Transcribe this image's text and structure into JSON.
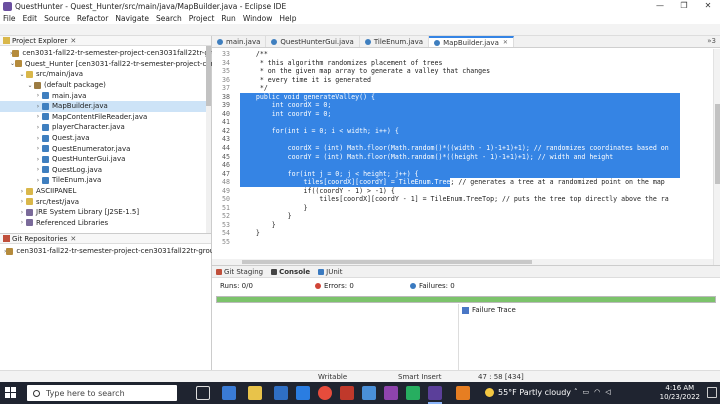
{
  "window": {
    "title": "QuestHunter - Quest_Hunter/src/main/java/MapBuilder.java - Eclipse IDE",
    "minimize": "—",
    "maximize": "❐",
    "close": "✕"
  },
  "menu": [
    "File",
    "Edit",
    "Source",
    "Refactor",
    "Navigate",
    "Search",
    "Project",
    "Run",
    "Window",
    "Help"
  ],
  "package_explorer": {
    "title": "Project Explorer",
    "items": [
      {
        "twist": ">",
        "icon": "proj",
        "label": "cen3031-fall22-tr-semester-project-cen3031fall22tr-group-2"
      },
      {
        "twist": "v",
        "icon": "proj",
        "label": "Quest_Hunter [cen3031-fall22-tr-semester-project-cen3031fall22"
      },
      {
        "twist": "v",
        "icon": "folder",
        "label": "src/main/java"
      },
      {
        "twist": "v",
        "icon": "pkg",
        "label": "(default package)"
      },
      {
        "twist": ">",
        "icon": "java",
        "label": "main.java"
      },
      {
        "twist": ">",
        "icon": "java",
        "label": "MapBuilder.java",
        "selected": true
      },
      {
        "twist": ">",
        "icon": "java",
        "label": "MapContentFileReader.java"
      },
      {
        "twist": ">",
        "icon": "java",
        "label": "playerCharacter.java"
      },
      {
        "twist": ">",
        "icon": "java",
        "label": "Quest.java"
      },
      {
        "twist": ">",
        "icon": "java",
        "label": "QuestEnumerator.java"
      },
      {
        "twist": ">",
        "icon": "java",
        "label": "QuestHunterGui.java"
      },
      {
        "twist": ">",
        "icon": "java",
        "label": "QuestLog.java"
      },
      {
        "twist": ">",
        "icon": "java",
        "label": "TileEnum.java"
      },
      {
        "twist": ">",
        "icon": "folder",
        "label": "ASCIIPANEL"
      },
      {
        "twist": ">",
        "icon": "folder",
        "label": "src/test/java"
      },
      {
        "twist": ">",
        "icon": "lib",
        "label": "JRE System Library [J2SE-1.5]"
      },
      {
        "twist": ">",
        "icon": "lib",
        "label": "Referenced Libraries"
      }
    ]
  },
  "git_repositories": {
    "title": "Git Repositories",
    "items": [
      {
        "twist": ">",
        "icon": "proj",
        "label": "cen3031-fall22-tr-semester-project-cen3031fall22tr-group-2 [U"
      }
    ]
  },
  "editor": {
    "tabs": [
      {
        "label": "main.java",
        "active": false
      },
      {
        "label": "QuestHunterGui.java",
        "active": false
      },
      {
        "label": "TileEnum.java",
        "active": false
      },
      {
        "label": "MapBuilder.java",
        "active": true
      }
    ],
    "tab_overflow": "»3",
    "lines": [
      {
        "n": "33",
        "text": "    /**",
        "cls": "cmt"
      },
      {
        "n": "34",
        "text": "     * this algorithm randomizes placement of trees",
        "cls": "cmt"
      },
      {
        "n": "35",
        "text": "     * on the given map array to generate a valley that changes",
        "cls": "cmt"
      },
      {
        "n": "36",
        "text": "     * every time it is generated",
        "cls": "cmt"
      },
      {
        "n": "37",
        "text": "     */",
        "cls": "cmt"
      },
      {
        "n": "38",
        "text": "    public void generateValley() {",
        "hl": true
      },
      {
        "n": "39",
        "text": "        int coordX = 0;",
        "hl": true
      },
      {
        "n": "40",
        "text": "        int coordY = 0;",
        "hl": true
      },
      {
        "n": "41",
        "text": "",
        "hl": true
      },
      {
        "n": "42",
        "text": "        for(int i = 0; i < width; i++) {",
        "hl": true
      },
      {
        "n": "43",
        "text": "",
        "hl": true
      },
      {
        "n": "44",
        "text": "            coordX = (int) Math.floor(Math.random()*((width - 1)-1+1)+1); // randomizes coordinates based on",
        "hl": true
      },
      {
        "n": "45",
        "text": "            coordY = (int) Math.floor(Math.random()*((height - 1)-1+1)+1); // width and height",
        "hl": true
      },
      {
        "n": "46",
        "text": "",
        "hl": true
      },
      {
        "n": "47",
        "text": "            for(int j = 0; j < height; j++) {",
        "hl": true
      },
      {
        "n": "48",
        "text": "                tiles[coordX][coordY] = TileEnum.Tree; // generates a tree at a randomized point on the map",
        "hl_partial": "                tiles[coordX][coordY] = TileEnum.Tree",
        "rest": "; // generates a tree at a randomized point on the map"
      },
      {
        "n": "49",
        "text": "                if((coordY - 1) > -1) {"
      },
      {
        "n": "50",
        "text": "                    tiles[coordX][coordY - 1] = TileEnum.TreeTop; // puts the tree top directly above the ra"
      },
      {
        "n": "51",
        "text": "                }"
      },
      {
        "n": "52",
        "text": "            }"
      },
      {
        "n": "53",
        "text": "        }"
      },
      {
        "n": "54",
        "text": "    }"
      },
      {
        "n": "55",
        "text": ""
      }
    ]
  },
  "bottom_panel": {
    "tabs": [
      "Git Staging",
      "Console",
      "JUnit"
    ],
    "active_tab": "Console",
    "runs_label": "Runs:",
    "runs_value": "0/0",
    "errors_label": "Errors:",
    "errors_value": "0",
    "failures_label": "Failures:",
    "failures_value": "0",
    "failure_trace": "Failure Trace",
    "progress_fraction": 1.0
  },
  "statusbar": {
    "writable": "Writable",
    "insert_mode": "Smart Insert",
    "position": "47 : 58 [434]"
  },
  "taskbar": {
    "search_placeholder": "Type here to search",
    "weather": "55°F  Partly cloudy",
    "time": "4:16 AM",
    "date": "10/23/2022",
    "colors": {
      "bg": "#1f2430",
      "accent": "#3584e4"
    }
  }
}
